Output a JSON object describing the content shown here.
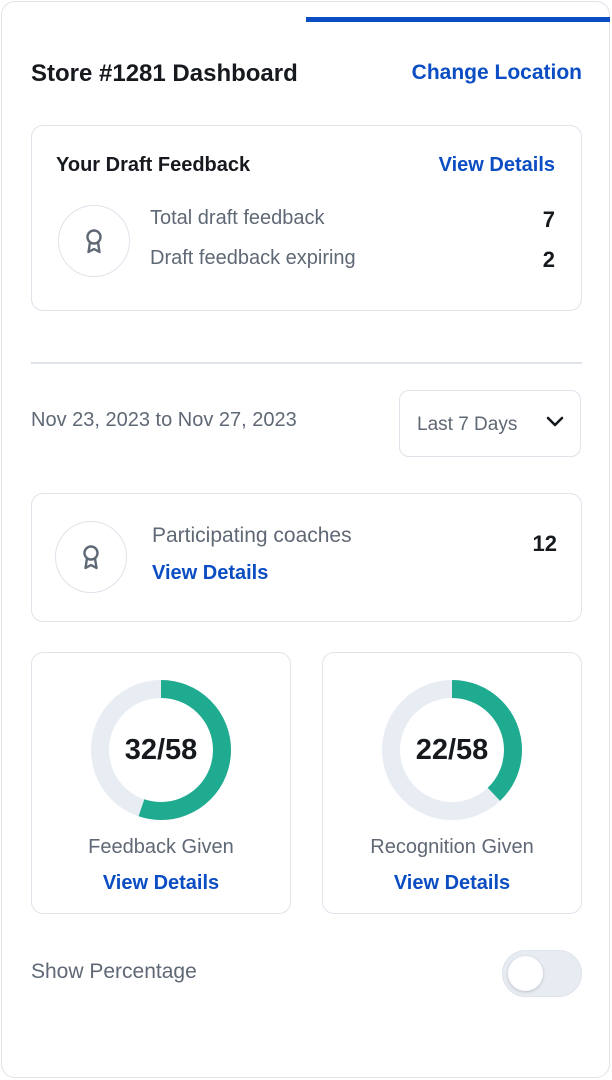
{
  "header": {
    "title": "Store #1281 Dashboard",
    "change_location": "Change Location"
  },
  "draft_feedback": {
    "title": "Your Draft Feedback",
    "view_details": "View Details",
    "icon": "award-ribbon-icon",
    "rows": [
      {
        "label": "Total draft feedback",
        "value": "7"
      },
      {
        "label": "Draft feedback expiring",
        "value": "2"
      }
    ]
  },
  "filter": {
    "date_range": "Nov 23, 2023 to Nov 27, 2023",
    "period_selected": "Last 7 Days"
  },
  "coaches": {
    "label": "Participating coaches",
    "view_details": "View Details",
    "count": "12",
    "icon": "award-ribbon-icon"
  },
  "stats": [
    {
      "value_text": "32/58",
      "given": 32,
      "total": 58,
      "label": "Feedback Given",
      "view_details": "View Details"
    },
    {
      "value_text": "22/58",
      "given": 22,
      "total": 58,
      "label": "Recognition Given",
      "view_details": "View Details"
    }
  ],
  "toggle": {
    "label": "Show Percentage",
    "on": false
  },
  "colors": {
    "accent": "#0b4dc2",
    "ring_fill": "#1fab90",
    "ring_track": "#e8ecf3"
  }
}
